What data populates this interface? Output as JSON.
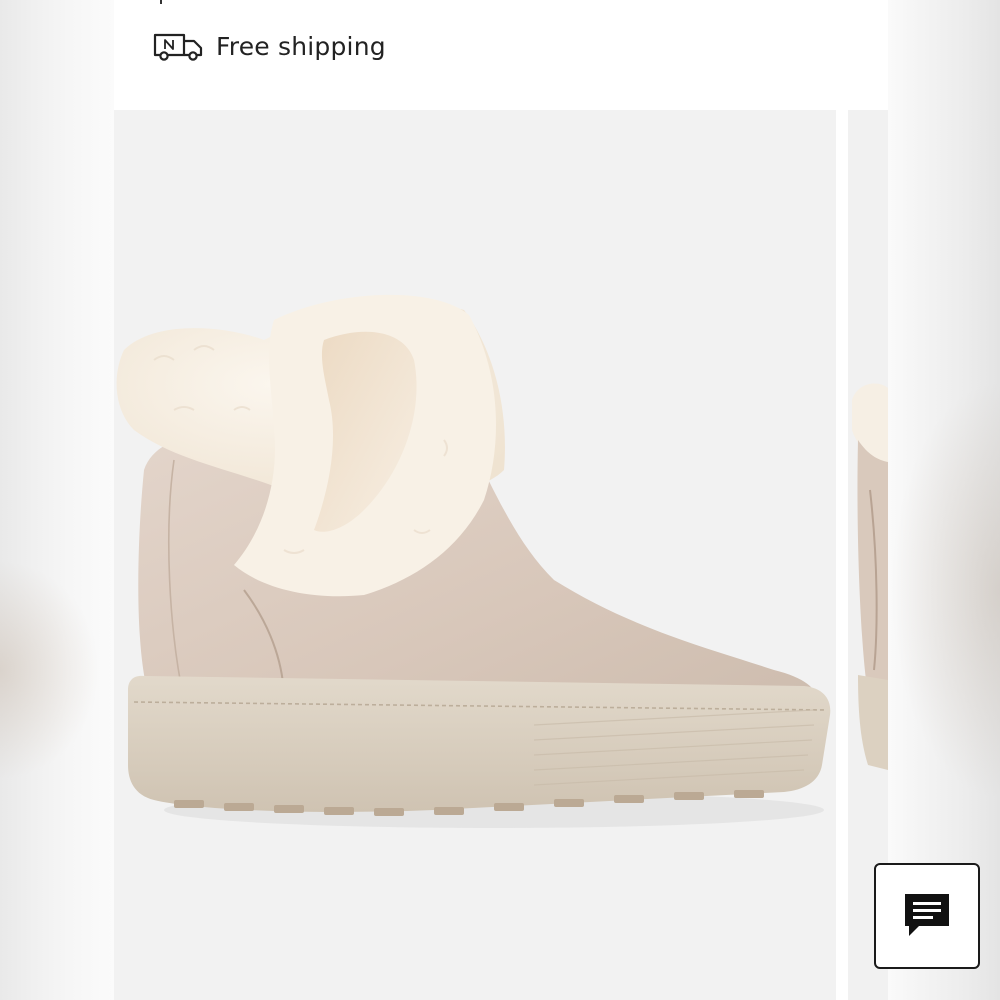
{
  "shipping": {
    "icon": "delivery-truck-icon",
    "label": "Free shipping"
  },
  "product_image": {
    "description_icon": "boot-photo",
    "slides_visible": 2
  },
  "chat": {
    "icon": "chat-bubble-icon"
  },
  "colors": {
    "text": "#222222",
    "image_bg": "#f2f2f2",
    "suede": "#d9c9bd",
    "fur": "#f6efe4",
    "sole": "#d8cdbd"
  }
}
